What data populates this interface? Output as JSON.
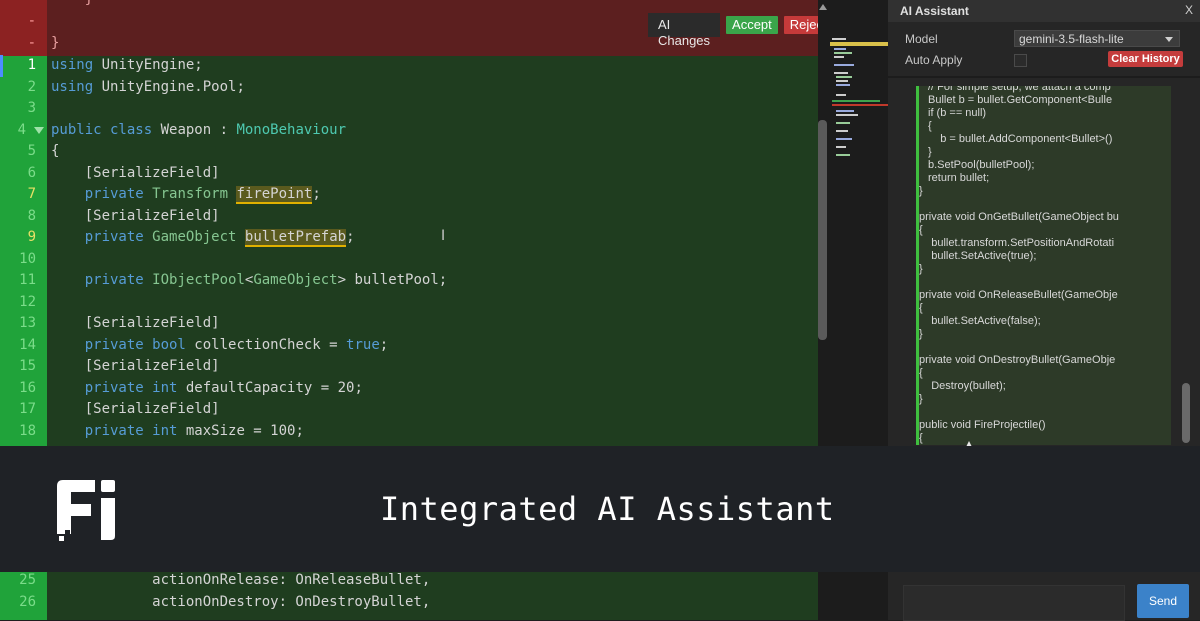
{
  "editor": {
    "removed_lines": [
      {
        "num": "-",
        "text": "    }"
      },
      {
        "num": "-",
        "text": ""
      },
      {
        "num": "-",
        "text": "}"
      }
    ],
    "lines": [
      {
        "num": "1",
        "text": "using UnityEngine;"
      },
      {
        "num": "2",
        "text": "using UnityEngine.Pool;"
      },
      {
        "num": "3",
        "text": ""
      },
      {
        "num": "4",
        "text": "public class Weapon : MonoBehaviour"
      },
      {
        "num": "5",
        "text": "{"
      },
      {
        "num": "6",
        "text": "    [SerializeField]"
      },
      {
        "num": "7",
        "text": "    private Transform firePoint;"
      },
      {
        "num": "8",
        "text": "    [SerializeField]"
      },
      {
        "num": "9",
        "text": "    private GameObject bulletPrefab;"
      },
      {
        "num": "10",
        "text": ""
      },
      {
        "num": "11",
        "text": "    private IObjectPool<GameObject> bulletPool;"
      },
      {
        "num": "12",
        "text": ""
      },
      {
        "num": "13",
        "text": "    [SerializeField]"
      },
      {
        "num": "14",
        "text": "    private bool collectionCheck = true;"
      },
      {
        "num": "15",
        "text": "    [SerializeField]"
      },
      {
        "num": "16",
        "text": "    private int defaultCapacity = 20;"
      },
      {
        "num": "17",
        "text": "    [SerializeField]"
      },
      {
        "num": "18",
        "text": "    private int maxSize = 100;"
      }
    ],
    "lines_after": [
      {
        "num": "25",
        "text": "            actionOnRelease: OnReleaseBullet,"
      },
      {
        "num": "26",
        "text": "            actionOnDestroy: OnDestroyBullet,"
      }
    ]
  },
  "ai_changes": {
    "label": "AI Changes",
    "accept": "Accept",
    "reject": "Reject"
  },
  "assistant": {
    "title": "AI Assistant",
    "close": "X",
    "model_label": "Model",
    "model_value": "gemini-3.5-flash-lite",
    "auto_apply_label": "Auto Apply",
    "auto_apply_checked": false,
    "clear_history": "Clear History",
    "code_lines": [
      "// For simple setup, we attach a comp",
      "Bullet b = bullet.GetComponent<Bulle",
      "if (b == null)",
      "{",
      "    b = bullet.AddComponent<Bullet>()",
      "}",
      "b.SetPool(bulletPool);",
      "return bullet;",
      "}",
      "",
      "private void OnGetBullet(GameObject bu",
      "{",
      "    bullet.transform.SetPositionAndRotati",
      "    bullet.SetActive(true);",
      "}",
      "",
      "private void OnReleaseBullet(GameObje",
      "{",
      "    bullet.SetActive(false);",
      "}",
      "",
      "private void OnDestroyBullet(GameObje",
      "{",
      "    Destroy(bullet);",
      "}",
      "",
      "public void FireProjectile()",
      "{"
    ],
    "send": "Send"
  },
  "banner": {
    "title": "Integrated AI Assistant",
    "logo_text": "Fi"
  },
  "colors": {
    "added_bg": "#1f3d1f",
    "added_gutter": "#20a33a",
    "removed_bg": "#5c1f1f",
    "accept": "#3aa54a",
    "reject": "#c53a3a",
    "send": "#3b82c9"
  }
}
